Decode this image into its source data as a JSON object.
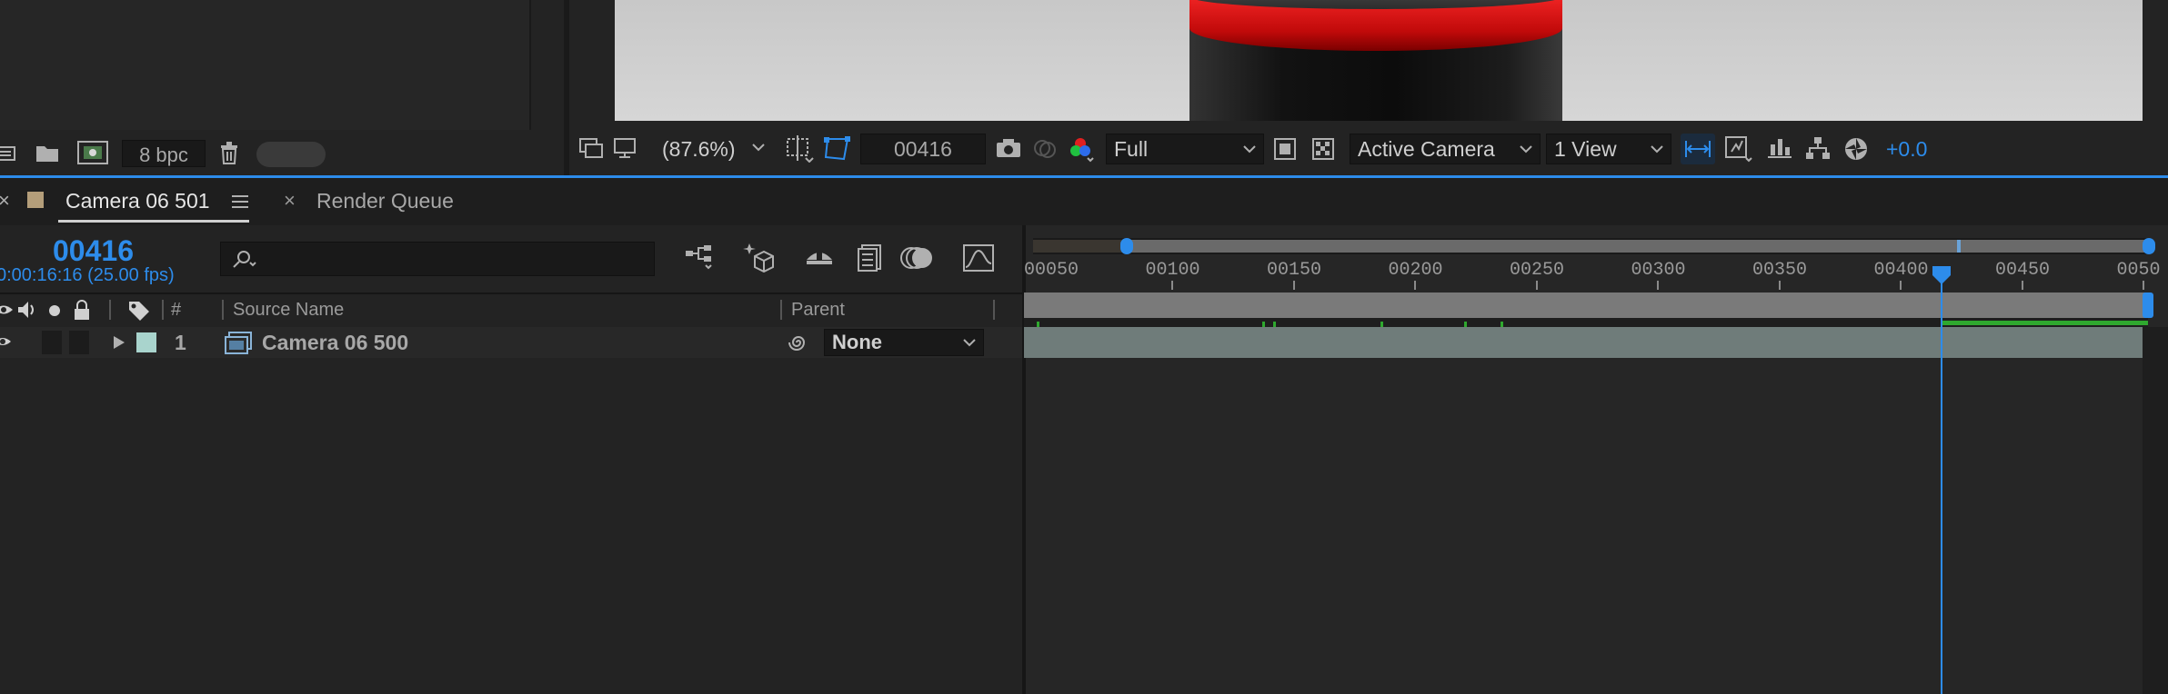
{
  "project_panel": {
    "bpc_label": "8 bpc"
  },
  "viewer": {
    "zoom": "(87.6%)",
    "frame": "00416",
    "resolution": "Full",
    "camera": "Active Camera",
    "views": "1 View",
    "exposure": "+0.0"
  },
  "tabs": [
    {
      "label": "Camera 06 501",
      "active": true
    },
    {
      "label": "Render Queue",
      "active": false
    }
  ],
  "timeline": {
    "current_frame": "00416",
    "timecode": "0:00:16:16 (25.00 fps)",
    "search_placeholder": "",
    "columns": {
      "number": "#",
      "source_name": "Source Name",
      "parent": "Parent"
    },
    "layers": [
      {
        "number": "1",
        "name": "Camera 06 500",
        "parent": "None",
        "label_color": "#a9d4cd"
      }
    ],
    "ruler": [
      "00050",
      "00100",
      "00150",
      "00200",
      "00250",
      "00300",
      "00350",
      "00400",
      "00450",
      "0050"
    ],
    "playhead_label_frame": 416
  },
  "colors": {
    "accent": "#2d8ceb",
    "layer_bar": "#6f7c7a",
    "work_area": "#7a7a7a",
    "comp_label": "#b49e7a"
  }
}
